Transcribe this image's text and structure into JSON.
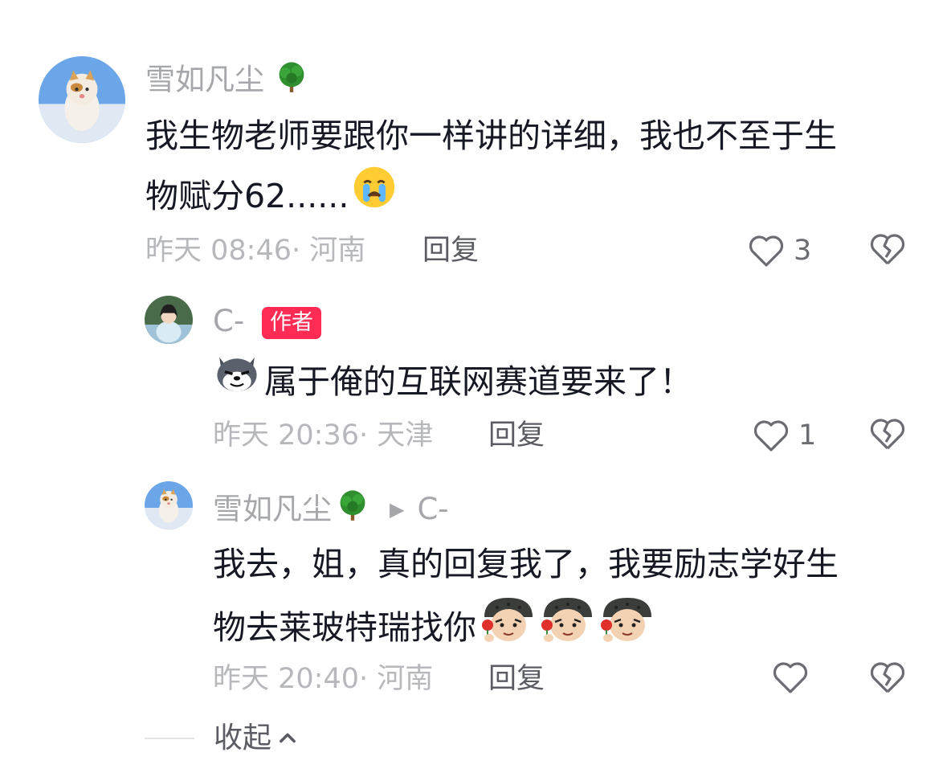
{
  "comments": [
    {
      "user": "雪如凡尘",
      "user_badge_icon": "tree-icon",
      "text_line1": "我生物老师要跟你一样讲的详细，我也不至于生",
      "text_line2": "物赋分62......",
      "emoji": "crying-face-emoji",
      "time": "昨天 08:46",
      "location": "· 河南",
      "reply_label": "回复",
      "likes": "3"
    },
    {
      "user": "C-",
      "author_badge": "作者",
      "emoji": "wolf-face-emoji",
      "text": "属于俺的互联网赛道要来了！",
      "time": "昨天 20:36",
      "location": "· 天津",
      "reply_label": "回复",
      "likes": "1"
    },
    {
      "user": "雪如凡尘",
      "user_badge_icon": "tree-icon",
      "reply_to": "C-",
      "text_line1": "我去，姐，真的回复我了，我要励志学好生",
      "text_line2": "物去莱玻特瑞找你",
      "emoji": "soldier-with-rose-emoji",
      "time": "昨天 20:40",
      "location": "· 河南",
      "reply_label": "回复",
      "likes": ""
    }
  ],
  "collapse_label": "收起",
  "colors": {
    "author_badge": "#fe2c55",
    "muted_text": "#a6a7ab",
    "body_text": "#161823"
  }
}
